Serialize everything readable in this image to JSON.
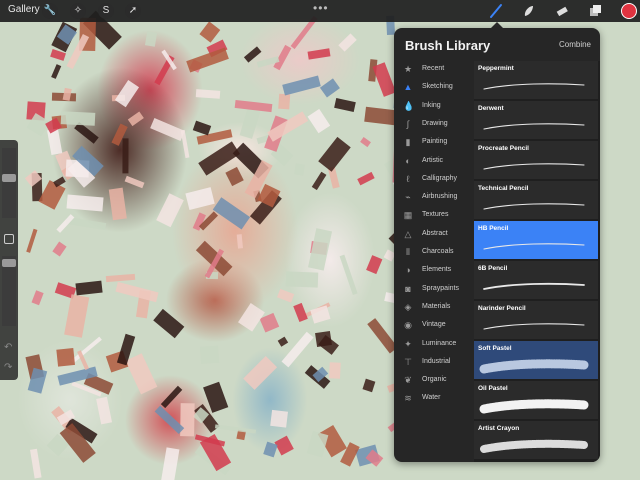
{
  "topbar": {
    "gallery_label": "Gallery",
    "left_tools": [
      "wrench-icon",
      "magic-wand-icon",
      "selection-icon",
      "transform-arrow-icon"
    ],
    "more": "•••",
    "right_tools": [
      "brush-icon",
      "smudge-icon",
      "eraser-icon",
      "layers-icon"
    ],
    "active_color": "#e03340",
    "active_tool_color": "#3b82f6"
  },
  "library": {
    "title": "Brush Library",
    "combine_label": "Combine",
    "categories": [
      {
        "label": "Recent",
        "icon": "star-icon"
      },
      {
        "label": "Sketching",
        "icon": "sketching-icon"
      },
      {
        "label": "Inking",
        "icon": "ink-drop-icon"
      },
      {
        "label": "Drawing",
        "icon": "drawing-icon"
      },
      {
        "label": "Painting",
        "icon": "paintbrush-icon"
      },
      {
        "label": "Artistic",
        "icon": "palette-icon"
      },
      {
        "label": "Calligraphy",
        "icon": "calligraphy-icon"
      },
      {
        "label": "Airbrushing",
        "icon": "airbrush-icon"
      },
      {
        "label": "Textures",
        "icon": "texture-icon"
      },
      {
        "label": "Abstract",
        "icon": "triangle-icon"
      },
      {
        "label": "Charcoals",
        "icon": "charcoal-icon"
      },
      {
        "label": "Elements",
        "icon": "yin-yang-icon"
      },
      {
        "label": "Spraypaints",
        "icon": "spraycan-icon"
      },
      {
        "label": "Materials",
        "icon": "cube-icon"
      },
      {
        "label": "Vintage",
        "icon": "vintage-icon"
      },
      {
        "label": "Luminance",
        "icon": "sparkle-icon"
      },
      {
        "label": "Industrial",
        "icon": "anvil-icon"
      },
      {
        "label": "Organic",
        "icon": "leaf-icon"
      },
      {
        "label": "Water",
        "icon": "waves-icon"
      }
    ],
    "active_category": "Sketching",
    "brushes": [
      {
        "name": "Peppermint",
        "style": "thin"
      },
      {
        "name": "Derwent",
        "style": "thin"
      },
      {
        "name": "Procreate Pencil",
        "style": "thin"
      },
      {
        "name": "Technical Pencil",
        "style": "thin"
      },
      {
        "name": "HB Pencil",
        "style": "thin",
        "selected": true
      },
      {
        "name": "6B Pencil",
        "style": "medium"
      },
      {
        "name": "Narinder Pencil",
        "style": "thin"
      },
      {
        "name": "Soft Pastel",
        "style": "pastel",
        "highlight": true
      },
      {
        "name": "Oil Pastel",
        "style": "thick"
      },
      {
        "name": "Artist Crayon",
        "style": "crayon"
      }
    ]
  }
}
